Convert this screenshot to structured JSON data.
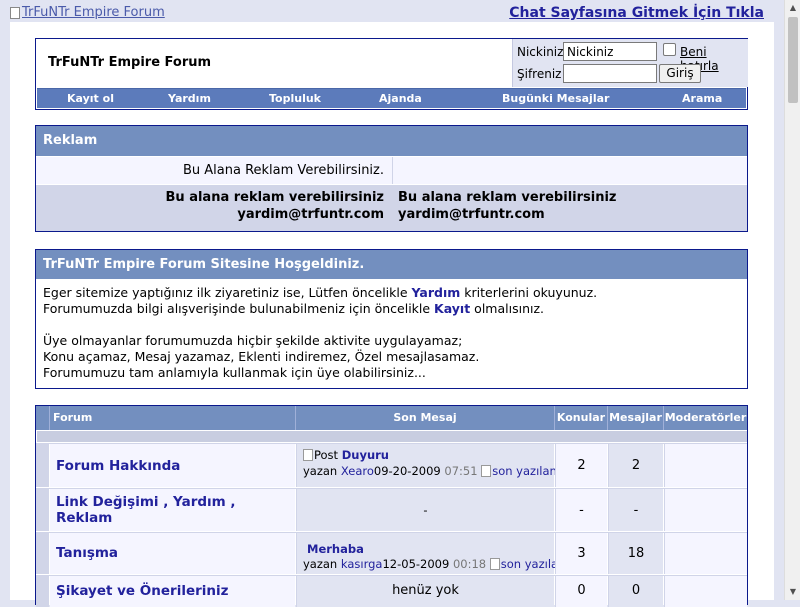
{
  "topbar": {
    "logo_alt": "TrFuNTr Empire Forum",
    "chat_link": "Chat Sayfasına Gitmek İçin Tıkla"
  },
  "header": {
    "site_title": "TrFuNTr Empire Forum",
    "login": {
      "username_label": "Nickiniz",
      "username_value": "Nickiniz",
      "remember_label": "Beni hatırla",
      "password_label": "Şifreniz",
      "login_button": "Giriş"
    },
    "nav": [
      "Kayıt ol",
      "Yardım",
      "Topluluk",
      "Ajanda",
      "Bugünki Mesajlar",
      "Arama"
    ]
  },
  "ads": {
    "title": "Reklam",
    "row1": "Bu Alana Reklam Verebilirsiniz.",
    "left_line1": "Bu alana reklam verebilirsiniz",
    "left_line2": "yardim@trfuntr.com",
    "right_line1": "Bu alana reklam verebilirsiniz",
    "right_line2": "yardim@trfuntr.com"
  },
  "welcome": {
    "title": "TrFuNTr Empire Forum Sitesine Hoşgeldiniz.",
    "line1_a": "Eger sitemize yaptığınız ilk ziyaretiniz ise, Lütfen öncelikle ",
    "line1_link": "Yardım",
    "line1_b": " kriterlerini okuyunuz.",
    "line2_a": "Forumumuzda bilgi alışverişinde bulunabilmeniz için öncelikle ",
    "line2_link": "Kayıt",
    "line2_b": " olmalısınız.",
    "line3": "Üye olmayanlar forumumuzda hiçbir şekilde aktivite uygulayamaz;",
    "line4": "Konu açamaz, Mesaj yazamaz, Eklenti indiremez, Özel mesajlasamaz.",
    "line5": "Forumumuzu tam anlamıyla kullanmak için üye olabilirsiniz..."
  },
  "forums": {
    "headers": {
      "forum": "Forum",
      "last_post": "Son Mesaj",
      "topics": "Konular",
      "posts": "Mesajlar",
      "moderators": "Moderatörler"
    },
    "rows": [
      {
        "name": "Forum Hakkında",
        "post_icon_alt": "Post",
        "last_title": "Duyuru",
        "by": "yazan",
        "author": "Xearo",
        "date": "09-20-2009",
        "time": "07:51",
        "goto_alt": "son yazılan Mesajı göster",
        "topics": "2",
        "posts": "2"
      },
      {
        "name_line1": "Link Değişimi , Yardım ,",
        "name_line2": "Reklam",
        "last_post": "-",
        "topics": "-",
        "posts": "-"
      },
      {
        "name": "Tanışma",
        "last_title": "Merhaba",
        "by": "yazan",
        "author": "kasırga",
        "date": "12-05-2009",
        "time": "00:18",
        "goto_alt": "son yazılan Mesajı göster",
        "topics": "3",
        "posts": "18"
      },
      {
        "name": "Şikayet ve Önerileriniz",
        "last_post": "henüz yok",
        "topics": "0",
        "posts": "0"
      }
    ]
  }
}
